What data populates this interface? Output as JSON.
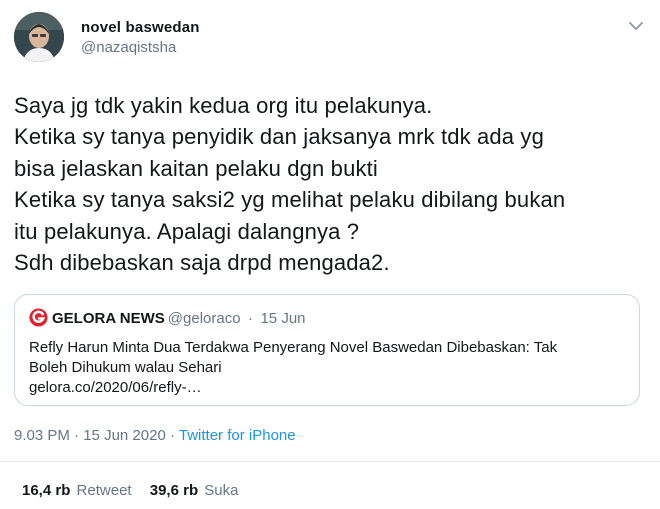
{
  "author": {
    "display_name": "novel baswedan",
    "handle": "@nazaqistsha"
  },
  "tweet": {
    "lines": [
      "Saya jg tdk yakin kedua org itu pelakunya.",
      "Ketika sy tanya penyidik dan jaksanya mrk tdk ada yg",
      "bisa jelaskan kaitan pelaku dgn bukti",
      "Ketika sy tanya saksi2 yg melihat pelaku dibilang bukan",
      "itu pelakunya. Apalagi dalangnya ?",
      "Sdh dibebaskan saja drpd mengada2."
    ]
  },
  "quote": {
    "name": "GELORA NEWS",
    "handle": "@geloraco",
    "separator": "·",
    "date": "15 Jun",
    "line1": "Refly Harun Minta Dua Terdakwa Penyerang Novel Baswedan Dibebaskan: Tak",
    "line2": "Boleh Dihukum walau Sehari",
    "link": "gelora.co/2020/06/refly-…"
  },
  "meta": {
    "time": "9.03 PM",
    "separator": "·",
    "date": "15 Jun 2020",
    "source": "Twitter for iPhone"
  },
  "stats": {
    "retweets_count": "16,4 rb",
    "retweets_label": "Retweet",
    "likes_count": "39,6 rb",
    "likes_label": "Suka"
  },
  "colors": {
    "accent": "#1b95e0",
    "muted": "#657786",
    "text": "#14171a",
    "border": "#ccd6dd",
    "brand_red": "#e0212b"
  },
  "icons": {
    "menu": "chevron-down-icon",
    "quote_logo": "gelora-logo-icon"
  }
}
